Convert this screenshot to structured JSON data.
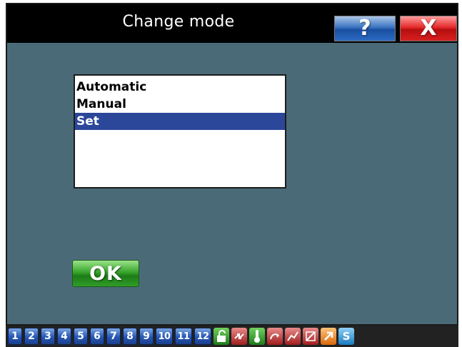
{
  "window": {
    "title": "Change mode",
    "help_glyph": "?",
    "close_glyph": "X"
  },
  "mode_list": {
    "items": [
      "Automatic",
      "Manual",
      "Set"
    ],
    "selected": "Set"
  },
  "ok_button": {
    "label": "OK"
  },
  "taskbar": {
    "numbers": [
      "1",
      "2",
      "3",
      "4",
      "5",
      "6",
      "7",
      "8",
      "9",
      "10",
      "11",
      "12"
    ],
    "icons": [
      {
        "name": "unlock-icon",
        "color": "#2e9d2a"
      },
      {
        "name": "swap-arrows-icon",
        "color": "#c23a3a"
      },
      {
        "name": "thermometer-icon",
        "color": "#2e9d2a"
      },
      {
        "name": "link-arrow-icon",
        "color": "#c23a3a"
      },
      {
        "name": "chart-icon",
        "color": "#c23a3a"
      },
      {
        "name": "no-chart-icon",
        "color": "#c23a3a"
      },
      {
        "name": "diagonal-arrow-icon",
        "color": "#f08a1e"
      },
      {
        "name": "s-icon",
        "color": "#2b9ad8"
      }
    ]
  },
  "colors": {
    "background": "#4b6a78",
    "titlebar": "#000000",
    "selection": "#2b479a",
    "ok_green": "#37a52c",
    "help_blue": "#2b6bc3",
    "close_red": "#d8201f"
  }
}
